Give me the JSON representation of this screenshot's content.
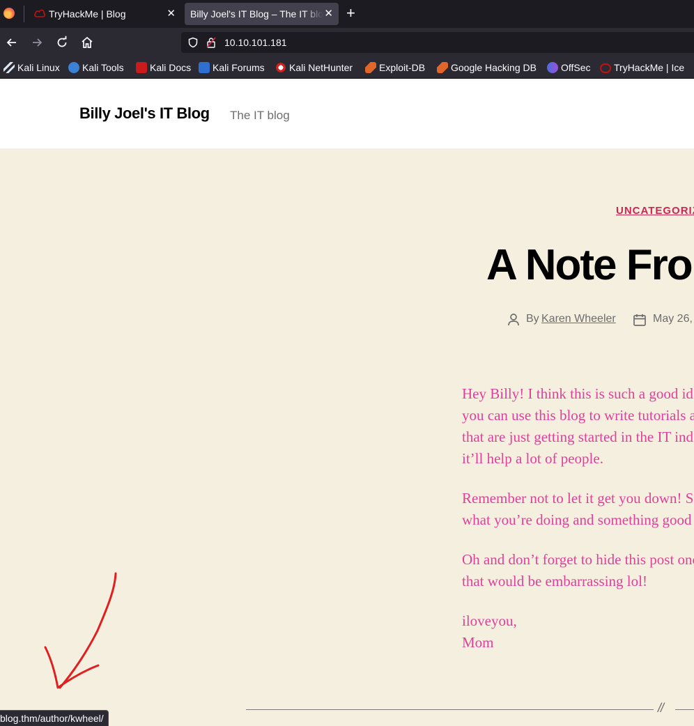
{
  "browser": {
    "tabs": [
      {
        "title": "TryHackMe | Blog",
        "active": false
      },
      {
        "title": "Billy Joel's IT Blog – The IT blog",
        "active": true
      }
    ],
    "url": "10.10.101.181",
    "bookmarks": [
      {
        "label": "Kali Linux",
        "icon": "kali-dragon-icon"
      },
      {
        "label": "Kali Tools",
        "icon": "kali-tools-icon"
      },
      {
        "label": "Kali Docs",
        "icon": "kali-docs-icon"
      },
      {
        "label": "Kali Forums",
        "icon": "kali-forums-icon"
      },
      {
        "label": "Kali NetHunter",
        "icon": "kali-nethunter-icon"
      },
      {
        "label": "Exploit-DB",
        "icon": "exploit-db-icon"
      },
      {
        "label": "Google Hacking DB",
        "icon": "ghdb-icon"
      },
      {
        "label": "OffSec",
        "icon": "offsec-icon"
      },
      {
        "label": "TryHackMe | Ice",
        "icon": "tryhackme-icon"
      }
    ],
    "status_url": "blog.thm/author/kwheel/"
  },
  "site": {
    "title": "Billy Joel's IT Blog",
    "description": "The IT blog"
  },
  "post": {
    "category": "UNCATEGORIZ",
    "title": "A Note Fro",
    "by_label": "By",
    "author": "Karen Wheeler",
    "date": "May 26,",
    "paragraphs": [
      [
        "Hey Billy!  I think this is such a good id",
        "you can use this blog to write tutorials a",
        "that are just getting started in the IT ind",
        "it’ll help a lot of people."
      ],
      [
        "Remember not to let it get you down!  S",
        "what you’re doing and something good"
      ],
      [
        "Oh and don’t forget to hide this post onc",
        "that would be embarrassing lol!"
      ],
      [
        "iloveyou,",
        "Mom"
      ]
    ],
    "separator": "//"
  },
  "colors": {
    "accent": "#cd2653",
    "content_text": "#e0409a",
    "page_bg": "#f5efe0",
    "annotation_arrow": "#e02020"
  }
}
